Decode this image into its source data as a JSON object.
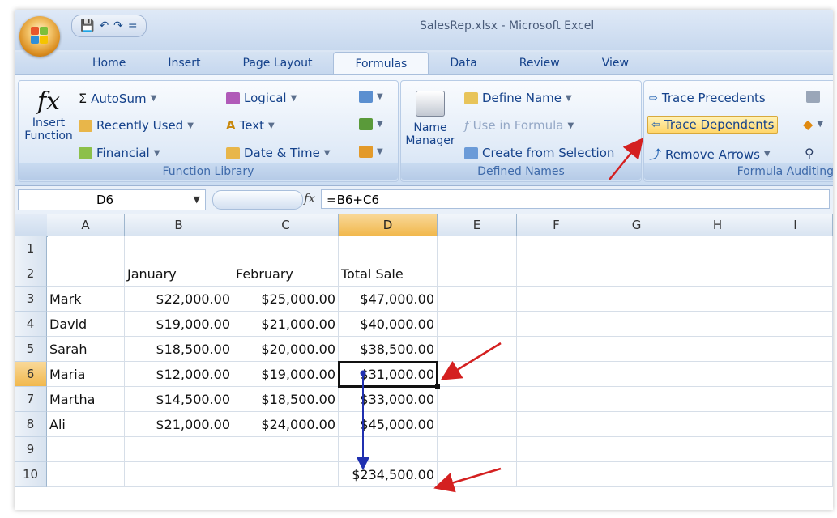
{
  "window": {
    "title": "SalesRep.xlsx - Microsoft Excel"
  },
  "quick_access": {
    "save_icon": "save-icon",
    "undo_icon": "undo-icon",
    "redo_icon": "redo-icon",
    "customize": "="
  },
  "tabs": [
    "Home",
    "Insert",
    "Page Layout",
    "Formulas",
    "Data",
    "Review",
    "View"
  ],
  "active_tab": "Formulas",
  "ribbon": {
    "function_library": {
      "label": "Function Library",
      "insert_function_line1": "Insert",
      "insert_function_line2": "Function",
      "fx_symbol": "fx",
      "autosum": "AutoSum",
      "recently_used": "Recently Used",
      "financial": "Financial",
      "logical": "Logical",
      "text": "Text",
      "date_time": "Date & Time"
    },
    "defined_names": {
      "label": "Defined Names",
      "name_manager_line1": "Name",
      "name_manager_line2": "Manager",
      "define_name": "Define Name",
      "use_in_formula": "Use in Formula",
      "create_from_selection": "Create from Selection"
    },
    "formula_auditing": {
      "label": "Formula Auditing",
      "trace_precedents": "Trace Precedents",
      "trace_dependents": "Trace Dependents",
      "remove_arrows": "Remove Arrows"
    }
  },
  "formula_bar": {
    "name_box": "D6",
    "fx": "fx",
    "formula": "=B6+C6"
  },
  "columns": [
    "A",
    "B",
    "C",
    "D",
    "E",
    "F",
    "G",
    "H",
    "I"
  ],
  "selected_column": "D",
  "rows": [
    "1",
    "2",
    "3",
    "4",
    "5",
    "6",
    "7",
    "8",
    "9",
    "10"
  ],
  "selected_row": "6",
  "sheet": {
    "headers": [
      "",
      "January",
      "February",
      "Total Sale"
    ],
    "data": [
      [
        "Mark",
        "$22,000.00",
        "$25,000.00",
        "$47,000.00"
      ],
      [
        "David",
        "$19,000.00",
        "$21,000.00",
        "$40,000.00"
      ],
      [
        "Sarah",
        "$18,500.00",
        "$20,000.00",
        "$38,500.00"
      ],
      [
        "Maria",
        "$12,000.00",
        "$19,000.00",
        "$31,000.00"
      ],
      [
        "Martha",
        "$14,500.00",
        "$18,500.00",
        "$33,000.00"
      ],
      [
        "Ali",
        "$21,000.00",
        "$24,000.00",
        "$45,000.00"
      ]
    ],
    "total": "$234,500.00"
  },
  "colors": {
    "annotation_arrow": "#d42020",
    "dependent_arrow": "#2030b0",
    "selection_header": "#f1b84d"
  }
}
